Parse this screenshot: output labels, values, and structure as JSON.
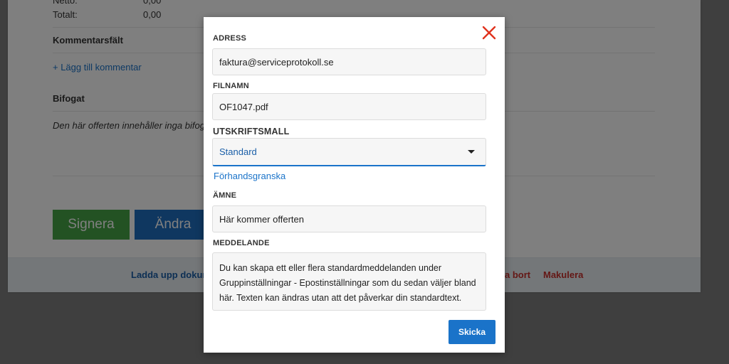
{
  "background": {
    "rows": [
      {
        "label": "Netto:",
        "value": "0,00"
      },
      {
        "label": "Totalt:",
        "value": "0,00"
      }
    ],
    "comments_heading": "Kommentarsfält",
    "add_comment_link": "+ Lägg till kommentar",
    "attachments_heading": "Bifogat",
    "no_attachments_text": "Den här offerten innehåller inga bifogade",
    "sign_button": "Signera",
    "edit_button": "Ändra",
    "footer_links": {
      "upload": "Ladda upp dokument",
      "remove": "a bort",
      "void": "Makulera"
    }
  },
  "modal": {
    "address": {
      "label": "ADRESS",
      "value": "faktura@serviceprotokoll.se"
    },
    "filename": {
      "label": "FILNAMN",
      "value": "OF1047.pdf"
    },
    "template": {
      "label": "UTSKRIFTSMALL",
      "selected": "Standard"
    },
    "preview_link": "Förhandsgranska",
    "subject": {
      "label": "ÄMNE",
      "value": "Här kommer offerten"
    },
    "message": {
      "label": "MEDDELANDE",
      "value": "Du kan skapa ett eller flera standardmeddelanden under Gruppinställningar - Epostinställningar som du sedan väljer bland här. Texten kan ändras utan att det påverkar din standardtext."
    },
    "send_button": "Skicka"
  },
  "colors": {
    "accent": "#1a73c9",
    "sign": "#47a447",
    "edit": "#1f6fc0",
    "close": "#e0321d",
    "danger": "#c9302c"
  },
  "icons": {
    "close": "close-icon",
    "dropdown": "chevron-down-icon"
  }
}
